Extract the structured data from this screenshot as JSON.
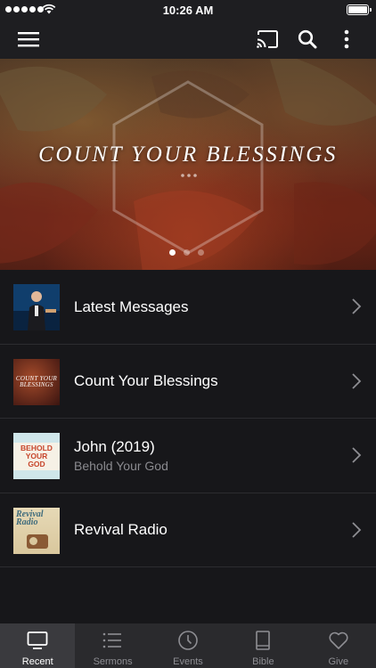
{
  "status_bar": {
    "time": "10:26 AM"
  },
  "nav": {
    "menu_icon": "hamburger-menu-icon",
    "cast_icon": "cast-icon",
    "search_icon": "search-icon",
    "more_icon": "more-vertical-icon"
  },
  "banner": {
    "title": "COUNT YOUR BLESSINGS",
    "page_count": 3,
    "active_page": 1
  },
  "list": [
    {
      "title": "Latest Messages",
      "subtitle": ""
    },
    {
      "title": "Count Your Blessings",
      "subtitle": "",
      "thumb_text": "COUNT YOUR BLESSINGS"
    },
    {
      "title": "John (2019)",
      "subtitle": "Behold Your God",
      "thumb_text": "BEHOLD YOUR GOD"
    },
    {
      "title": "Revival Radio",
      "subtitle": "",
      "thumb_text": "Revival Radio"
    }
  ],
  "tabs": [
    {
      "label": "Recent",
      "icon": "tv-icon",
      "active": true
    },
    {
      "label": "Sermons",
      "icon": "list-icon",
      "active": false
    },
    {
      "label": "Events",
      "icon": "clock-icon",
      "active": false
    },
    {
      "label": "Bible",
      "icon": "book-icon",
      "active": false
    },
    {
      "label": "Give",
      "icon": "heart-icon",
      "active": false
    }
  ],
  "colors": {
    "background": "#17171a",
    "bar": "#1e1e21",
    "tab_bar": "#2a2a2d",
    "inactive": "#8e8e93"
  }
}
